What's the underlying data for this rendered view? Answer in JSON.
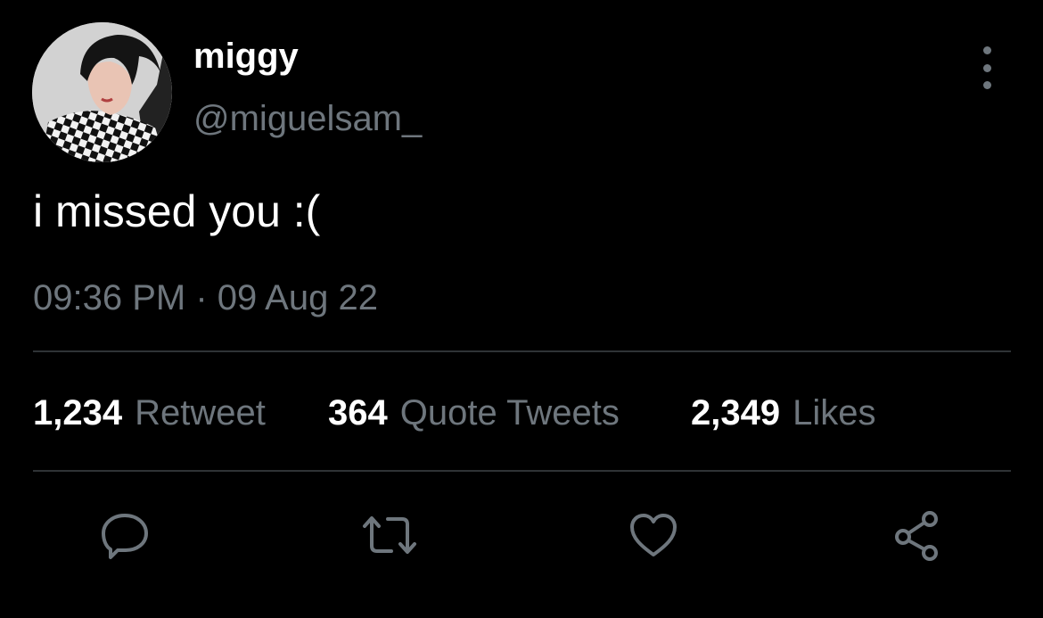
{
  "user": {
    "display_name": "miggy",
    "handle": "@miguelsam_"
  },
  "tweet": {
    "text": "i missed you :(",
    "timestamp": "09:36 PM · 09 Aug 22"
  },
  "stats": {
    "retweets": {
      "count": "1,234",
      "label": "Retweet"
    },
    "quotes": {
      "count": "364",
      "label": "Quote Tweets"
    },
    "likes": {
      "count": "2,349",
      "label": "Likes"
    }
  },
  "actions": [
    "reply-icon",
    "retweet-icon",
    "like-icon",
    "share-icon"
  ],
  "colors": {
    "background": "#000000",
    "primary_text": "#ffffff",
    "secondary_text": "#6e767d",
    "divider": "#2f3336"
  }
}
